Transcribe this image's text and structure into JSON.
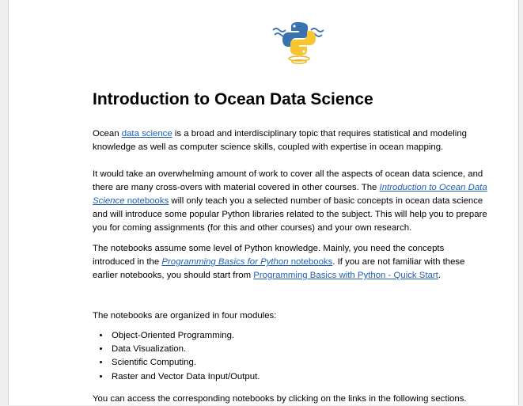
{
  "heading": "Introduction to Ocean Data Science",
  "p1": {
    "t1": "Ocean ",
    "link": "data science",
    "t2": " is a broad and interdisciplinary topic that requires statistical and modeling knowledge as well as computer science skills, coupled with expertise in ocean mapping."
  },
  "p2": {
    "t1": "It would take an overwhelming amount of work to cover all the aspects of ocean data science, and there are many cross-overs with material covered in other courses. The ",
    "link_italic": "Introduction to Ocean Data Science",
    "link_rest": " notebooks",
    "t2": " will only teach you a selected number of basic concepts in ocean data science and will introduce some popular Python libraries related to the subject. This will help you to prepare you for coming assignments (for this and other courses) and your own research."
  },
  "p3": {
    "t1": "The notebooks assume some level of Python knowledge. Mainly, you need the concepts introduced in the ",
    "link1_italic": "Programming Basics for Python",
    "link1_rest": " notebooks",
    "t2": ". If you are not familiar with these earlier notebooks, you should start from ",
    "link2": "Programming Basics with Python - Quick Start",
    "t3": "."
  },
  "p4": "The notebooks are organized in four modules:",
  "modules": [
    "Object-Oriented Programming.",
    "Data Visualization.",
    "Scientific Computing.",
    "Raster and Vector Data Input/Output."
  ],
  "p5": "You can access the corresponding notebooks by clicking on the links in the following sections."
}
